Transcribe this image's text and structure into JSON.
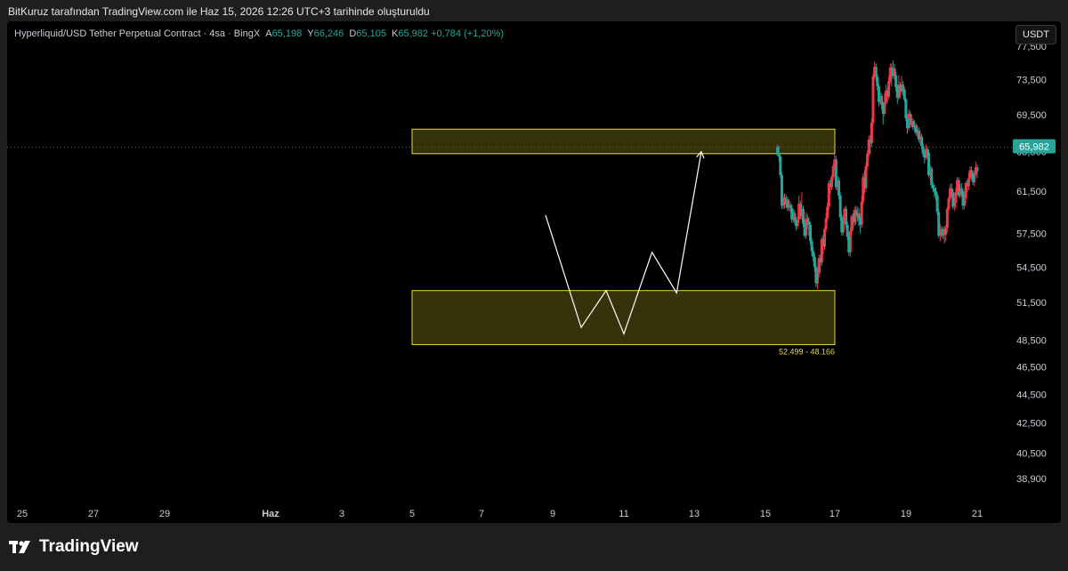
{
  "header": {
    "credit": "BitKuruz tarafından TradingView.com ile Haz 15, 2026 12:26 UTC+3 tarihinde oluşturuldu"
  },
  "legend": {
    "symbol": "Hyperliquid/USD Tether Perpetual Contract · 4sa · BingX",
    "o_label": "A",
    "o_value": "65,198",
    "h_label": "Y",
    "h_value": "66,246",
    "l_label": "D",
    "l_value": "65,105",
    "c_label": "K",
    "c_value": "65,982",
    "change": "+0,784 (+1,20%)"
  },
  "currency_button": "USDT",
  "footer": {
    "brand": "TradingView",
    "logo_icon": "tradingview-logo-icon"
  },
  "colors": {
    "up": "#26a69a",
    "down": "#f23645",
    "zone_border": "#e6d93a",
    "zone_fill": "rgba(120,110,20,0.45)",
    "price_label": "#26a69a",
    "zone_text": "#e6d93a"
  },
  "chart_data": {
    "type": "candlestick",
    "symbol": "HYPEUSDT",
    "timeframe": "4sa",
    "last_price": 65.982,
    "last_price_label": "65,982",
    "y_axis": {
      "ticks": [
        77.5,
        73.5,
        69.5,
        65.5,
        61.5,
        57.5,
        54.5,
        51.5,
        48.5,
        46.5,
        44.5,
        42.5,
        40.5,
        38.9
      ],
      "tick_labels": [
        "77,500",
        "73,500",
        "69,500",
        "65,500",
        "61,500",
        "57,500",
        "54,500",
        "51,500",
        "48,500",
        "46,500",
        "44,500",
        "42,500",
        "40,500",
        "38,900"
      ],
      "scale": "log"
    },
    "x_axis": {
      "ticks": [
        "25",
        "27",
        "29",
        "Haz",
        "3",
        "5",
        "7",
        "9",
        "11",
        "13",
        "15",
        "17",
        "19",
        "21"
      ]
    },
    "zones": [
      {
        "name": "resistance",
        "top": 67.9,
        "bottom": 65.3,
        "from": "5",
        "to": "17"
      },
      {
        "name": "support",
        "top": 52.499,
        "bottom": 48.166,
        "from": "5",
        "to": "17",
        "label": "52.499 - 48.166"
      }
    ],
    "pattern_path": [
      {
        "x": "8.8",
        "y": 59.2
      },
      {
        "x": "9.8",
        "y": 49.5
      },
      {
        "x": "10.5",
        "y": 52.5
      },
      {
        "x": "11.0",
        "y": 49.0
      },
      {
        "x": "11.8",
        "y": 55.8
      },
      {
        "x": "12.5",
        "y": 52.3
      },
      {
        "x": "13.2",
        "y": 65.5
      }
    ],
    "candles": [
      [
        63.5,
        64.2,
        62.8,
        63.9
      ],
      [
        63.9,
        64.5,
        63.0,
        63.2
      ],
      [
        63.2,
        63.6,
        62.0,
        62.4
      ],
      [
        62.4,
        63.5,
        62.1,
        63.3
      ],
      [
        63.3,
        64.0,
        62.7,
        63.6
      ],
      [
        63.6,
        64.0,
        62.5,
        62.8
      ],
      [
        62.8,
        63.3,
        61.6,
        62.0
      ],
      [
        62.0,
        62.6,
        61.4,
        62.3
      ],
      [
        62.3,
        62.5,
        60.3,
        60.8
      ],
      [
        60.8,
        61.3,
        59.8,
        60.1
      ],
      [
        60.1,
        61.8,
        59.7,
        61.5
      ],
      [
        61.5,
        62.3,
        61.0,
        61.8
      ],
      [
        61.8,
        62.2,
        60.8,
        61.1
      ],
      [
        61.1,
        62.9,
        60.9,
        62.6
      ],
      [
        62.6,
        62.9,
        61.2,
        61.4
      ],
      [
        61.4,
        61.8,
        59.8,
        60.4
      ],
      [
        60.4,
        60.9,
        59.6,
        60.0
      ],
      [
        60.0,
        61.7,
        59.8,
        61.4
      ],
      [
        61.4,
        62.3,
        61.0,
        61.8
      ],
      [
        61.8,
        62.2,
        60.5,
        60.8
      ],
      [
        60.8,
        61.0,
        59.6,
        59.8
      ],
      [
        59.8,
        60.0,
        57.6,
        58.0
      ],
      [
        58.0,
        58.3,
        56.8,
        57.4
      ],
      [
        57.4,
        58.2,
        56.6,
        57.9
      ],
      [
        57.9,
        58.1,
        57.0,
        57.3
      ],
      [
        57.3,
        58.2,
        57.1,
        57.9
      ],
      [
        57.9,
        58.4,
        56.8,
        57.3
      ],
      [
        57.3,
        59.8,
        57.1,
        59.5
      ],
      [
        59.5,
        61.4,
        59.2,
        61.1
      ],
      [
        61.1,
        61.9,
        60.6,
        61.5
      ],
      [
        61.5,
        62.2,
        60.9,
        61.8
      ],
      [
        61.8,
        62.4,
        61.4,
        62.1
      ],
      [
        62.1,
        64.0,
        61.8,
        63.8
      ],
      [
        63.8,
        64.2,
        62.6,
        63.1
      ],
      [
        63.1,
        65.7,
        62.9,
        65.4
      ],
      [
        65.4,
        66.1,
        64.8,
        65.8
      ],
      [
        65.8,
        66.3,
        64.6,
        64.9
      ],
      [
        64.9,
        65.6,
        64.3,
        65.3
      ],
      [
        65.3,
        66.4,
        65.0,
        66.1
      ],
      [
        66.1,
        67.4,
        65.8,
        67.1
      ],
      [
        67.1,
        67.7,
        66.3,
        66.8
      ],
      [
        66.8,
        68.1,
        66.5,
        67.8
      ],
      [
        67.8,
        68.4,
        67.1,
        67.5
      ],
      [
        67.5,
        68.6,
        67.2,
        68.3
      ],
      [
        68.3,
        68.9,
        67.6,
        68.1
      ],
      [
        68.1,
        69.1,
        67.8,
        68.8
      ],
      [
        68.8,
        69.5,
        68.1,
        68.4
      ],
      [
        68.4,
        69.9,
        68.1,
        69.6
      ],
      [
        69.6,
        70.1,
        67.7,
        68.0
      ],
      [
        68.0,
        69.4,
        67.4,
        69.1
      ],
      [
        69.1,
        71.4,
        68.8,
        71.2
      ],
      [
        71.2,
        72.6,
        70.9,
        72.3
      ],
      [
        72.3,
        73.3,
        71.6,
        72.9
      ],
      [
        72.9,
        73.9,
        71.8,
        72.1
      ],
      [
        72.1,
        73.2,
        71.3,
        72.9
      ],
      [
        72.9,
        74.0,
        71.1,
        71.4
      ],
      [
        71.4,
        72.9,
        70.7,
        72.6
      ],
      [
        72.6,
        74.4,
        72.1,
        74.0
      ],
      [
        74.0,
        75.3,
        73.5,
        74.8
      ],
      [
        74.8,
        75.8,
        73.6,
        73.9
      ],
      [
        73.9,
        75.4,
        72.7,
        74.9
      ],
      [
        74.9,
        75.4,
        73.0,
        73.3
      ],
      [
        73.3,
        73.9,
        71.2,
        71.5
      ],
      [
        71.5,
        72.5,
        70.7,
        72.2
      ],
      [
        72.2,
        72.9,
        70.6,
        70.9
      ],
      [
        70.9,
        71.9,
        69.3,
        69.6
      ],
      [
        69.6,
        70.9,
        68.4,
        70.6
      ],
      [
        70.6,
        71.9,
        70.1,
        71.6
      ],
      [
        71.6,
        72.1,
        70.6,
        70.9
      ],
      [
        70.9,
        73.0,
        70.4,
        72.7
      ],
      [
        72.7,
        74.1,
        72.2,
        73.8
      ],
      [
        73.8,
        75.4,
        73.3,
        75.0
      ],
      [
        75.0,
        75.6,
        73.6,
        73.9
      ],
      [
        73.9,
        74.2,
        68.3,
        68.6
      ],
      [
        68.6,
        69.1,
        66.0,
        66.4
      ],
      [
        66.4,
        67.3,
        65.2,
        66.8
      ],
      [
        66.8,
        67.2,
        64.9,
        65.3
      ],
      [
        65.3,
        65.6,
        63.7,
        64.0
      ],
      [
        64.0,
        64.4,
        61.4,
        61.8
      ],
      [
        61.8,
        63.6,
        61.3,
        62.9
      ],
      [
        62.9,
        63.3,
        60.2,
        60.5
      ],
      [
        60.5,
        61.1,
        58.0,
        58.3
      ],
      [
        58.3,
        59.1,
        57.5,
        58.8
      ],
      [
        58.8,
        59.9,
        58.2,
        59.4
      ],
      [
        59.4,
        60.0,
        58.6,
        59.1
      ],
      [
        59.1,
        60.1,
        58.3,
        59.7
      ],
      [
        59.7,
        60.0,
        58.2,
        58.5
      ],
      [
        58.5,
        59.4,
        57.9,
        59.1
      ],
      [
        59.1,
        59.3,
        57.4,
        57.7
      ],
      [
        57.7,
        58.0,
        55.4,
        55.8
      ],
      [
        55.8,
        57.6,
        55.5,
        57.2
      ],
      [
        57.2,
        58.6,
        56.9,
        58.3
      ],
      [
        58.3,
        60.1,
        58.0,
        59.8
      ],
      [
        59.8,
        60.0,
        58.4,
        58.7
      ],
      [
        58.7,
        59.2,
        57.3,
        57.6
      ],
      [
        57.6,
        59.3,
        57.3,
        59.0
      ],
      [
        59.0,
        61.4,
        58.7,
        61.1
      ],
      [
        61.1,
        62.9,
        60.7,
        62.6
      ],
      [
        62.6,
        63.0,
        61.6,
        61.9
      ],
      [
        61.9,
        65.1,
        61.6,
        64.7
      ],
      [
        64.7,
        65.3,
        63.6,
        64.0
      ],
      [
        64.0,
        64.3,
        62.6,
        62.9
      ],
      [
        62.9,
        63.1,
        61.6,
        61.9
      ],
      [
        61.9,
        62.6,
        61.3,
        62.3
      ],
      [
        62.3,
        62.6,
        59.7,
        60.0
      ],
      [
        60.0,
        60.4,
        58.6,
        58.9
      ],
      [
        58.9,
        59.4,
        57.6,
        57.9
      ],
      [
        57.9,
        58.1,
        56.0,
        56.3
      ],
      [
        56.3,
        57.4,
        55.6,
        57.0
      ],
      [
        57.0,
        57.2,
        54.6,
        54.9
      ],
      [
        54.9,
        55.6,
        54.1,
        55.3
      ],
      [
        55.3,
        55.6,
        53.6,
        53.9
      ],
      [
        53.9,
        54.4,
        52.6,
        53.1
      ],
      [
        53.1,
        54.8,
        52.8,
        54.5
      ],
      [
        54.5,
        55.7,
        54.1,
        55.4
      ],
      [
        55.4,
        56.3,
        55.0,
        55.9
      ],
      [
        55.9,
        57.1,
        55.5,
        56.8
      ],
      [
        56.8,
        58.6,
        56.5,
        58.3
      ],
      [
        58.3,
        59.0,
        57.3,
        58.6
      ],
      [
        58.6,
        59.3,
        57.9,
        58.9
      ],
      [
        58.9,
        59.5,
        57.0,
        57.3
      ],
      [
        57.3,
        58.7,
        57.1,
        58.4
      ],
      [
        58.4,
        60.1,
        58.1,
        59.8
      ],
      [
        59.8,
        61.4,
        58.8,
        59.1
      ],
      [
        59.1,
        60.6,
        58.8,
        60.3
      ],
      [
        60.3,
        61.1,
        58.5,
        58.8
      ],
      [
        58.8,
        59.1,
        57.9,
        58.2
      ],
      [
        58.2,
        59.0,
        57.8,
        58.7
      ],
      [
        58.7,
        59.7,
        58.4,
        59.4
      ],
      [
        59.4,
        59.8,
        58.5,
        58.8
      ],
      [
        58.8,
        60.2,
        58.5,
        59.9
      ],
      [
        59.9,
        60.5,
        59.5,
        60.2
      ],
      [
        60.2,
        60.7,
        59.6,
        59.9
      ],
      [
        59.9,
        61.0,
        59.6,
        60.7
      ],
      [
        60.7,
        61.2,
        59.9,
        60.2
      ],
      [
        60.2,
        61.3,
        59.8,
        60.9
      ],
      [
        60.9,
        61.2,
        59.8,
        60.1
      ],
      [
        60.1,
        63.4,
        59.8,
        63.1
      ],
      [
        63.1,
        65.4,
        62.8,
        65.0
      ],
      [
        65.0,
        66.1,
        64.5,
        65.2
      ],
      [
        65.198,
        66.246,
        65.105,
        65.982
      ]
    ]
  }
}
